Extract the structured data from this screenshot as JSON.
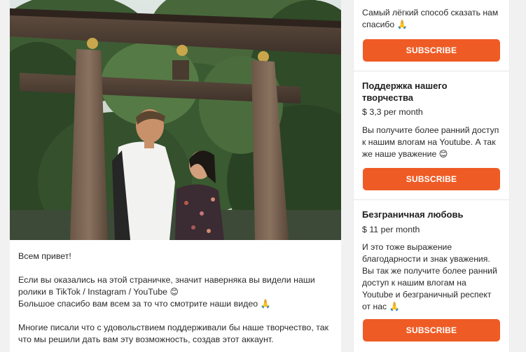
{
  "post": {
    "image_alt": "Couple under torii gate",
    "greeting": "Всем привет!",
    "paragraph1_line1": "Если вы оказались на этой страничке, значит наверняка вы видели наши",
    "paragraph1_line2": "ролики в TikTok / Instagram / YouTube",
    "paragraph1_emoji": "😊",
    "paragraph1_line3": "Большое спасибо вам всем за то что смотрите наши видео",
    "paragraph1_line3_emoji": "🙏",
    "paragraph2_line1": "Многие писали что с удовольствием поддерживали бы наше творчество, так",
    "paragraph2_line2": "что мы решили дать вам эту возможность, создав этот аккаунт."
  },
  "tiers": [
    {
      "title": "",
      "price": "",
      "description_lines": [
        "Самый лёгкий способ сказать нам",
        "спасибо 🙏"
      ],
      "button": "SUBSCRIBE"
    },
    {
      "title_line1": "Поддержка нашего",
      "title_line2": "творчества",
      "price": "$ 3,3 per month",
      "description_lines": [
        "Вы получите более ранний доступ",
        "к нашим влогам на Youtube. А так",
        "же наше уважение 😊"
      ],
      "button": "SUBSCRIBE"
    },
    {
      "title_line1": "Безграничная любовь",
      "price": "$ 11 per month",
      "description_lines": [
        "И это тоже выражение",
        "благодарности и знак уважения.",
        "Вы так же получите более ранний",
        "доступ к нашим влогам на",
        "Youtube и безграничный респект",
        "от нас 🙏"
      ],
      "button": "SUBSCRIBE"
    }
  ],
  "colors": {
    "accent": "#ef5b25",
    "background": "#f1f1f1",
    "card": "#ffffff"
  }
}
